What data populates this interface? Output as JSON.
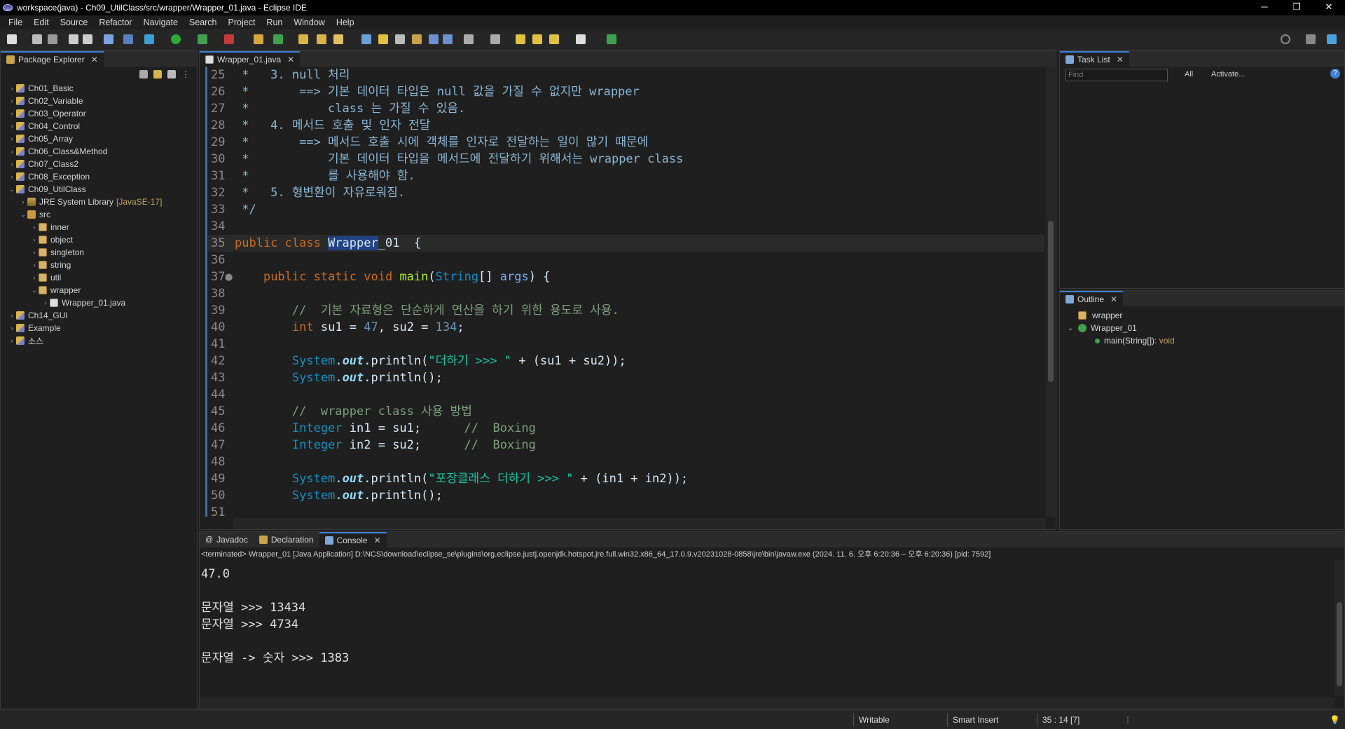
{
  "window": {
    "title": "workspace(java) - Ch09_UtilClass/src/wrapper/Wrapper_01.java - Eclipse IDE",
    "minimize": "─",
    "restore": "❐",
    "close": "✕"
  },
  "menu": [
    "File",
    "Edit",
    "Source",
    "Refactor",
    "Navigate",
    "Search",
    "Project",
    "Run",
    "Window",
    "Help"
  ],
  "package_explorer": {
    "tab_label": "Package Explorer",
    "items": [
      {
        "label": "Ch01_Basic",
        "indent": 0,
        "arrow": "›",
        "kind": "proj"
      },
      {
        "label": "Ch02_Variable",
        "indent": 0,
        "arrow": "›",
        "kind": "proj"
      },
      {
        "label": "Ch03_Operator",
        "indent": 0,
        "arrow": "›",
        "kind": "proj"
      },
      {
        "label": "Ch04_Control",
        "indent": 0,
        "arrow": "›",
        "kind": "proj"
      },
      {
        "label": "Ch05_Array",
        "indent": 0,
        "arrow": "›",
        "kind": "proj"
      },
      {
        "label": "Ch06_Class&Method",
        "indent": 0,
        "arrow": "›",
        "kind": "proj"
      },
      {
        "label": "Ch07_Class2",
        "indent": 0,
        "arrow": "›",
        "kind": "proj"
      },
      {
        "label": "Ch08_Exception",
        "indent": 0,
        "arrow": "›",
        "kind": "proj"
      },
      {
        "label": "Ch09_UtilClass",
        "indent": 0,
        "arrow": "⌄",
        "kind": "proj"
      },
      {
        "label": "JRE System Library",
        "deco": "[JavaSE-17]",
        "indent": 1,
        "arrow": "›",
        "kind": "lib"
      },
      {
        "label": "src",
        "indent": 1,
        "arrow": "⌄",
        "kind": "src"
      },
      {
        "label": "inner",
        "indent": 2,
        "arrow": "›",
        "kind": "pkg"
      },
      {
        "label": "object",
        "indent": 2,
        "arrow": "›",
        "kind": "pkg"
      },
      {
        "label": "singleton",
        "indent": 2,
        "arrow": "›",
        "kind": "pkg"
      },
      {
        "label": "string",
        "indent": 2,
        "arrow": "›",
        "kind": "pkg"
      },
      {
        "label": "util",
        "indent": 2,
        "arrow": "›",
        "kind": "pkg"
      },
      {
        "label": "wrapper",
        "indent": 2,
        "arrow": "⌄",
        "kind": "pkg"
      },
      {
        "label": "Wrapper_01.java",
        "indent": 3,
        "arrow": "›",
        "kind": "java"
      },
      {
        "label": "Ch14_GUI",
        "indent": 0,
        "arrow": "›",
        "kind": "proj"
      },
      {
        "label": "Example",
        "indent": 0,
        "arrow": "›",
        "kind": "proj"
      },
      {
        "label": "소스",
        "indent": 0,
        "arrow": "›",
        "kind": "proj"
      }
    ]
  },
  "editor": {
    "tab_label": "Wrapper_01.java",
    "lines": [
      {
        "n": "25",
        "parts": [
          [
            "c-com",
            " *   3. null 처리"
          ]
        ]
      },
      {
        "n": "26",
        "parts": [
          [
            "c-com",
            " *       ==> 기본 데이터 타입은 null 값을 가질 수 없지만 wrapper"
          ]
        ]
      },
      {
        "n": "27",
        "parts": [
          [
            "c-com",
            " *           class 는 가질 수 있음."
          ]
        ]
      },
      {
        "n": "28",
        "parts": [
          [
            "c-com",
            " *   4. 메서드 호출 및 인자 전달"
          ]
        ]
      },
      {
        "n": "29",
        "parts": [
          [
            "c-com",
            " *       ==> 메서드 호출 시에 객체를 인자로 전달하는 일이 많기 때문에"
          ]
        ]
      },
      {
        "n": "30",
        "parts": [
          [
            "c-com",
            " *           기본 데이터 타입을 메서드에 전달하기 위해서는 wrapper class"
          ]
        ]
      },
      {
        "n": "31",
        "parts": [
          [
            "c-com",
            " *           를 사용해야 함."
          ]
        ]
      },
      {
        "n": "32",
        "parts": [
          [
            "c-com",
            " *   5. 형변환이 자유로워짐."
          ]
        ]
      },
      {
        "n": "33",
        "parts": [
          [
            "c-com",
            " */"
          ]
        ]
      },
      {
        "n": "34",
        "parts": []
      },
      {
        "n": "35",
        "hl": true,
        "parts": [
          [
            "c-kw",
            "public class "
          ],
          [
            "c-sel",
            "Wrapper"
          ],
          [
            "c-cls",
            "_01"
          ],
          [
            "",
            "  {"
          ]
        ]
      },
      {
        "n": "36",
        "parts": []
      },
      {
        "n": "37●",
        "parts": [
          [
            "",
            "    "
          ],
          [
            "c-kw",
            "public static void "
          ],
          [
            "c-mth",
            "main"
          ],
          [
            "",
            "("
          ],
          [
            "c-type",
            "String"
          ],
          [
            "",
            "[] "
          ],
          [
            "c-var",
            "args"
          ],
          [
            "",
            ") {"
          ]
        ]
      },
      {
        "n": "38",
        "parts": []
      },
      {
        "n": "39",
        "parts": [
          [
            "",
            "        "
          ],
          [
            "c-cmt2",
            "//  기본 자료형은 단순하게 연산을 하기 위한 용도로 사용."
          ]
        ]
      },
      {
        "n": "40",
        "parts": [
          [
            "",
            "        "
          ],
          [
            "c-kw",
            "int "
          ],
          [
            "",
            "su1 = "
          ],
          [
            "c-num",
            "47"
          ],
          [
            "",
            ", su2 = "
          ],
          [
            "c-num",
            "134"
          ],
          [
            "",
            ";"
          ]
        ]
      },
      {
        "n": "41",
        "parts": []
      },
      {
        "n": "42",
        "parts": [
          [
            "",
            "        "
          ],
          [
            "c-type",
            "System"
          ],
          [
            "",
            "."
          ],
          [
            "c-fld",
            "out"
          ],
          [
            "",
            ".println("
          ],
          [
            "c-str",
            "\"더하기 >>> \""
          ],
          [
            "",
            " + (su1 + su2));"
          ]
        ]
      },
      {
        "n": "43",
        "parts": [
          [
            "",
            "        "
          ],
          [
            "c-type",
            "System"
          ],
          [
            "",
            "."
          ],
          [
            "c-fld",
            "out"
          ],
          [
            "",
            ".println();"
          ]
        ]
      },
      {
        "n": "44",
        "parts": []
      },
      {
        "n": "45",
        "parts": [
          [
            "",
            "        "
          ],
          [
            "c-cmt2",
            "//  wrapper class 사용 방법"
          ]
        ]
      },
      {
        "n": "46",
        "parts": [
          [
            "",
            "        "
          ],
          [
            "c-type",
            "Integer "
          ],
          [
            "",
            "in1 = su1;      "
          ],
          [
            "c-cmt2",
            "//  Boxing"
          ]
        ]
      },
      {
        "n": "47",
        "parts": [
          [
            "",
            "        "
          ],
          [
            "c-type",
            "Integer "
          ],
          [
            "",
            "in2 = su2;      "
          ],
          [
            "c-cmt2",
            "//  Boxing"
          ]
        ]
      },
      {
        "n": "48",
        "parts": []
      },
      {
        "n": "49",
        "parts": [
          [
            "",
            "        "
          ],
          [
            "c-type",
            "System"
          ],
          [
            "",
            "."
          ],
          [
            "c-fld",
            "out"
          ],
          [
            "",
            ".println("
          ],
          [
            "c-str",
            "\"포장클래스 더하기 >>> \""
          ],
          [
            "",
            " + (in1 + in2));"
          ]
        ]
      },
      {
        "n": "50",
        "parts": [
          [
            "",
            "        "
          ],
          [
            "c-type",
            "System"
          ],
          [
            "",
            "."
          ],
          [
            "c-fld",
            "out"
          ],
          [
            "",
            ".println();"
          ]
        ]
      },
      {
        "n": "51",
        "parts": []
      }
    ]
  },
  "task_list": {
    "tab_label": "Task List",
    "find_placeholder": "Find",
    "all_label": "All",
    "activate_label": "Activate..."
  },
  "outline": {
    "tab_label": "Outline",
    "items": [
      {
        "label": "wrapper",
        "type": ""
      },
      {
        "label": "Wrapper_01",
        "type": ""
      },
      {
        "label": "main(String[])",
        "type": " : void"
      }
    ]
  },
  "bottom": {
    "tabs": [
      "Javadoc",
      "Declaration",
      "Console"
    ],
    "console_header": "<terminated> Wrapper_01 [Java Application] D:\\NCS\\download\\eclipse_se\\plugins\\org.eclipse.justj.openjdk.hotspot.jre.full.win32.x86_64_17.0.9.v20231028-0858\\jre\\bin\\javaw.exe  (2024. 11. 6. 오후 6:20:36 – 오후 6:20:36) [pid: 7592]",
    "console_lines": [
      "47.0",
      "",
      "문자열 >>> 13434",
      "문자열 >>> 4734",
      "",
      "문자열 -> 숫자 >>> 1383"
    ]
  },
  "status": {
    "writable": "Writable",
    "insert_mode": "Smart Insert",
    "position": "35 : 14 [7]"
  }
}
